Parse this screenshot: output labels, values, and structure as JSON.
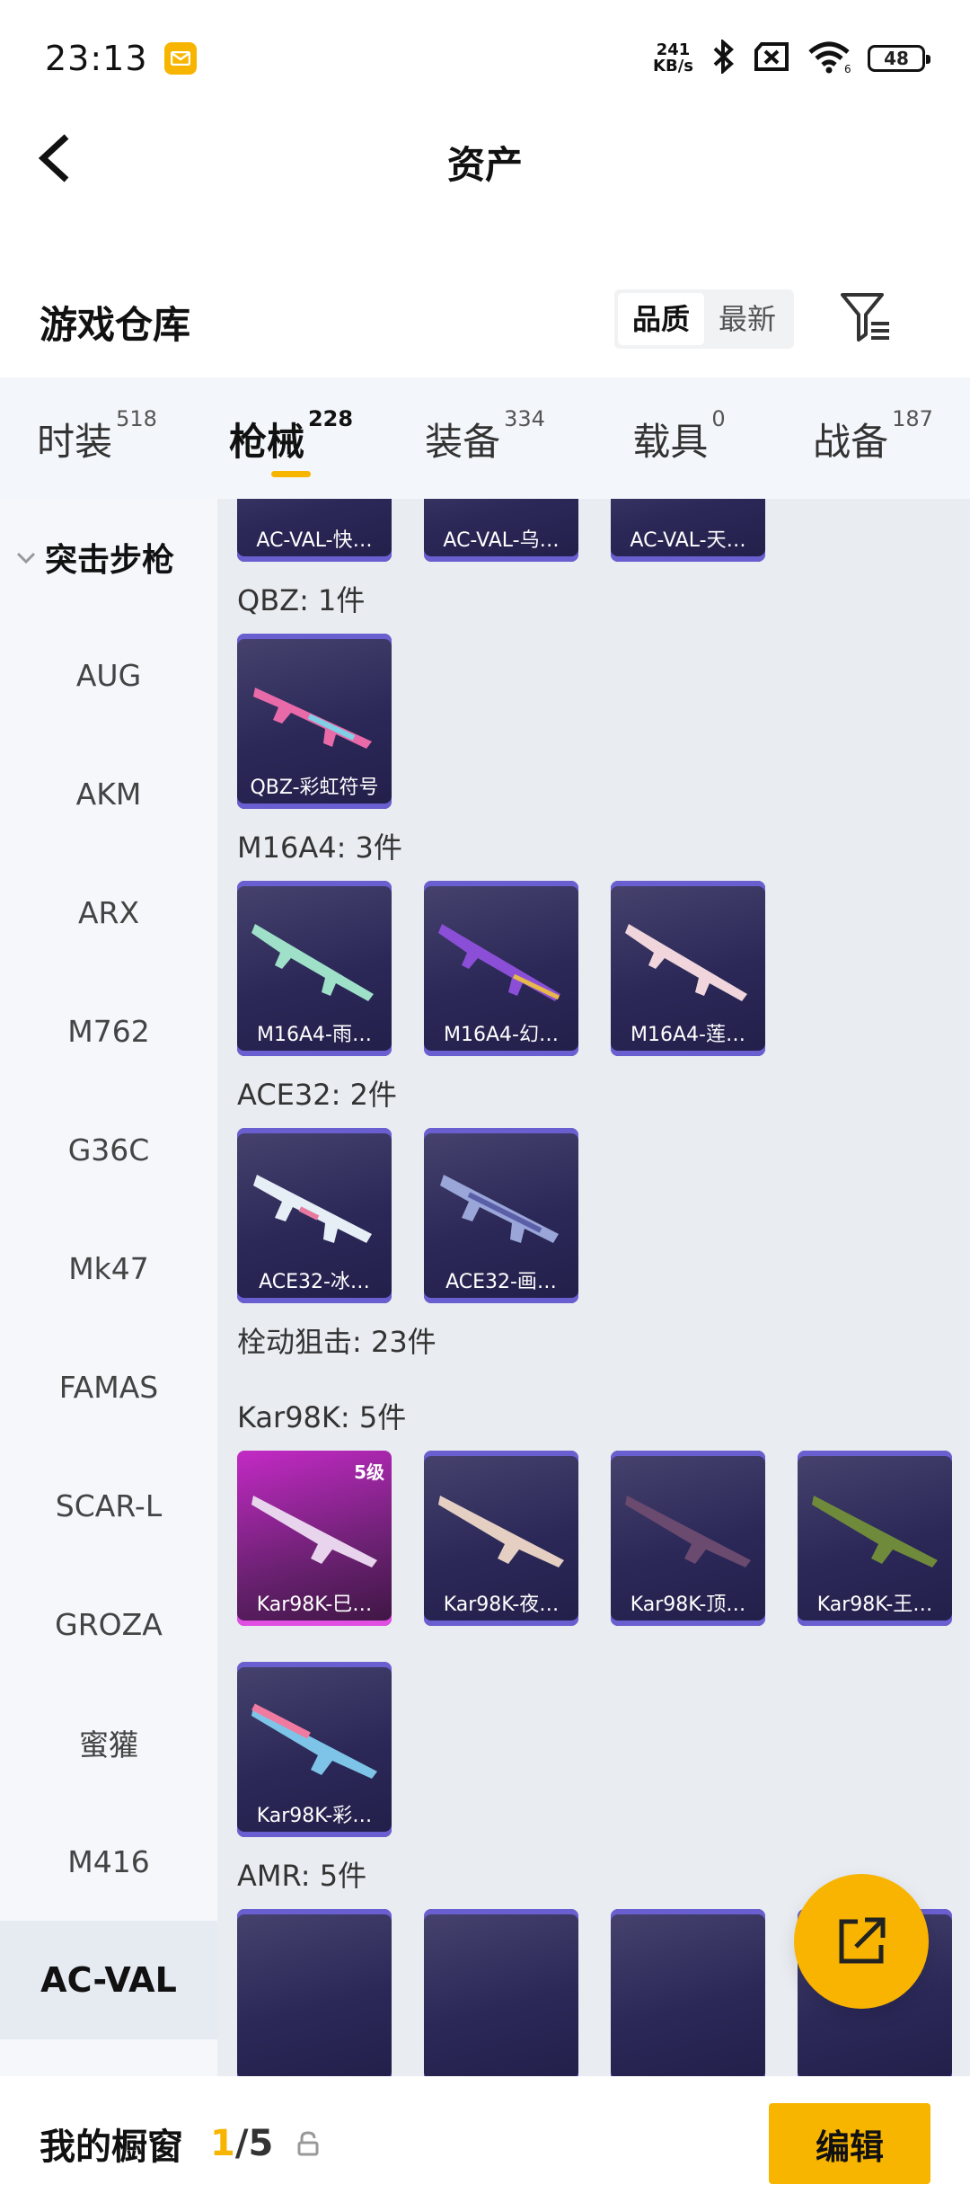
{
  "status_bar": {
    "time": "23:13",
    "net_speed_value": "241",
    "net_speed_unit": "KB/s",
    "wifi_label": "6",
    "battery": "48"
  },
  "header": {
    "title": "资产"
  },
  "section": {
    "title": "游戏仓库",
    "sort_options": [
      "品质",
      "最新"
    ],
    "sort_selected": "品质"
  },
  "tabs": [
    {
      "label": "时装",
      "count": "518"
    },
    {
      "label": "枪械",
      "count": "228",
      "active": true
    },
    {
      "label": "装备",
      "count": "334"
    },
    {
      "label": "载具",
      "count": "0"
    },
    {
      "label": "战备",
      "count": "187"
    }
  ],
  "sidebar": {
    "category": "突击步枪",
    "items": [
      "AUG",
      "AKM",
      "ARX",
      "M762",
      "G36C",
      "Mk47",
      "FAMAS",
      "SCAR-L",
      "GROZA",
      "蜜獾",
      "M416",
      "AC-VAL"
    ],
    "selected": "AC-VAL"
  },
  "content": {
    "top_items": [
      "AC-VAL-快…",
      "AC-VAL-乌…",
      "AC-VAL-天…"
    ],
    "groups": [
      {
        "label": "QBZ: 1件",
        "items": [
          "QBZ-彩虹符号"
        ]
      },
      {
        "label": "M16A4: 3件",
        "items": [
          "M16A4-雨…",
          "M16A4-幻…",
          "M16A4-莲…"
        ]
      },
      {
        "label": "ACE32: 2件",
        "items": [
          "ACE32-冰…",
          "ACE32-画…"
        ]
      }
    ],
    "category_label": "栓动狙击: 23件",
    "kar_group": {
      "label": "Kar98K: 5件",
      "items": [
        "Kar98K-巳…",
        "Kar98K-夜…",
        "Kar98K-顶…",
        "Kar98K-王…",
        "Kar98K-彩…"
      ],
      "first_level": "5级"
    },
    "amr_group": {
      "label": "AMR: 5件"
    }
  },
  "bottom_bar": {
    "label": "我的橱窗",
    "current": "1",
    "total": "/5",
    "edit_label": "编辑"
  },
  "colors": {
    "accent": "#f7b500",
    "card_purple": "#2b2858",
    "card_gold": "#c32ac5"
  }
}
